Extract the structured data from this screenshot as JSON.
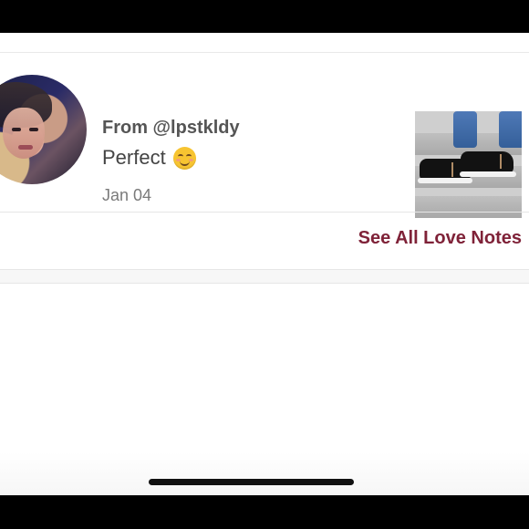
{
  "love_note": {
    "from": "From @lpstkldy",
    "message": "Perfect",
    "emoji_icon": "smiling-face-icon",
    "date": "Jan 04"
  },
  "actions": {
    "see_all_label": "See All Love Notes"
  },
  "colors": {
    "accent": "#7f2238",
    "text_primary": "#555555",
    "text_secondary": "#7a7a7a",
    "background": "#ffffff"
  }
}
